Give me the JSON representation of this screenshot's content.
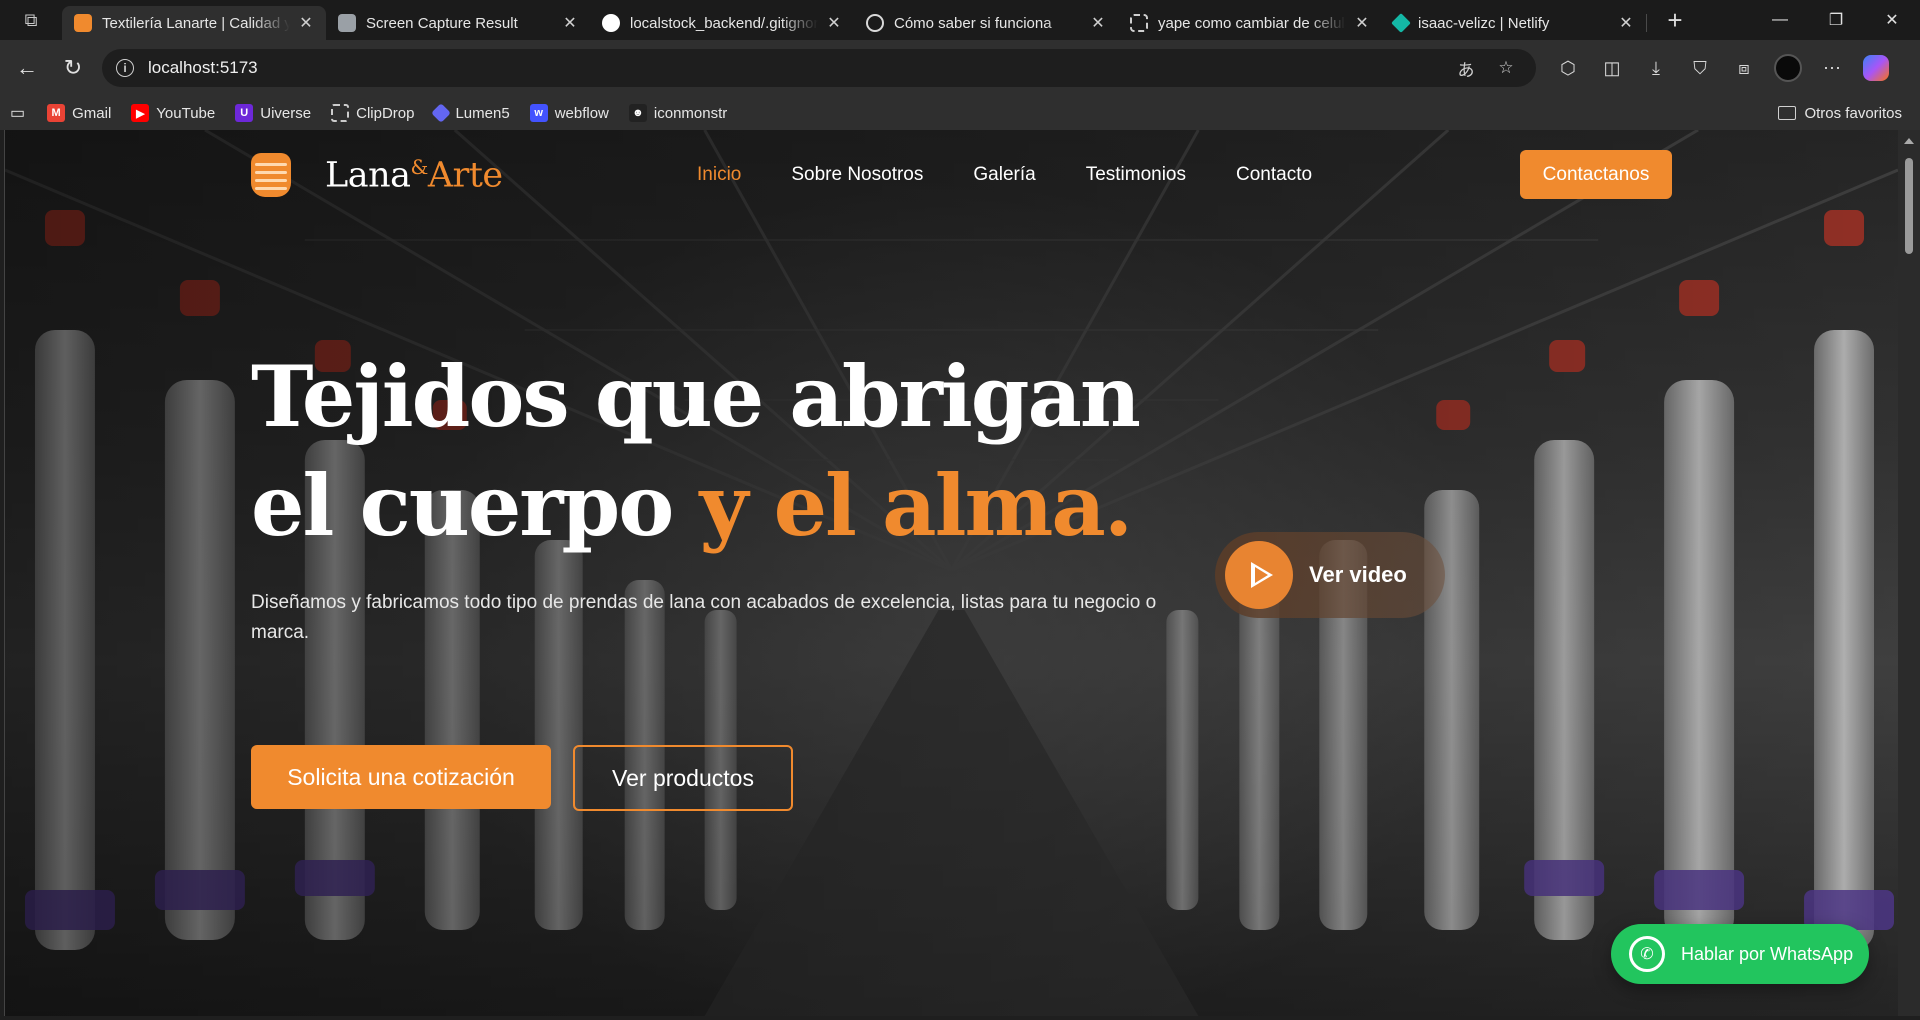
{
  "browser": {
    "tabs": [
      {
        "title": "Textilería Lanarte | Calidad y",
        "active": true,
        "favicon_color": "#f08a2e"
      },
      {
        "title": "Screen Capture Result",
        "active": false,
        "favicon_color": "#9aa0a6"
      },
      {
        "title": "localstock_backend/.gitignore",
        "active": false,
        "favicon_color": "#ffffff"
      },
      {
        "title": "Cómo saber si funciona",
        "active": false,
        "favicon_color": "#d9d9d9"
      },
      {
        "title": "yape como cambiar de celular",
        "active": false,
        "favicon_color": "#cfcfcf"
      },
      {
        "title": "isaac-velizc | Netlify",
        "active": false,
        "favicon_color": "#14b8a6"
      }
    ],
    "url": "localhost:5173",
    "bookmarks": [
      {
        "label": "Gmail",
        "icon": "gmail-icon",
        "color": "#ea4335"
      },
      {
        "label": "YouTube",
        "icon": "youtube-icon",
        "color": "#ff0000"
      },
      {
        "label": "Uiverse",
        "icon": "uiverse-icon",
        "color": "#6d28d9"
      },
      {
        "label": "ClipDrop",
        "icon": "clipdrop-icon",
        "color": "#3a3a3a"
      },
      {
        "label": "Lumen5",
        "icon": "lumen5-icon",
        "color": "#6366f1"
      },
      {
        "label": "webflow",
        "icon": "webflow-icon",
        "color": "#4353ff"
      },
      {
        "label": "iconmonstr",
        "icon": "iconmonstr-icon",
        "color": "#222222"
      }
    ],
    "other_favorites": "Otros favoritos"
  },
  "site": {
    "logo": {
      "part1": "Lana",
      "amp": "&",
      "part2": "Arte"
    },
    "menu": [
      {
        "label": "Inicio",
        "active": true
      },
      {
        "label": "Sobre Nosotros",
        "active": false
      },
      {
        "label": "Galería",
        "active": false
      },
      {
        "label": "Testimonios",
        "active": false
      },
      {
        "label": "Contacto",
        "active": false
      }
    ],
    "cta_top": "Contactanos",
    "headline": {
      "line1": "Tejidos que abrigan",
      "line2_white": "el cuerpo",
      "line2_accent": "y el alma."
    },
    "subtitle": "Diseñamos y fabricamos todo tipo de prendas de lana con acabados de excelencia, listas para tu negocio o marca.",
    "video_label": "Ver video",
    "primary_button": "Solicita una cotización",
    "secondary_button": "Ver productos",
    "whatsapp_label": "Hablar por WhatsApp",
    "accent_color": "#f08a2e",
    "whatsapp_color": "#22c55e"
  }
}
